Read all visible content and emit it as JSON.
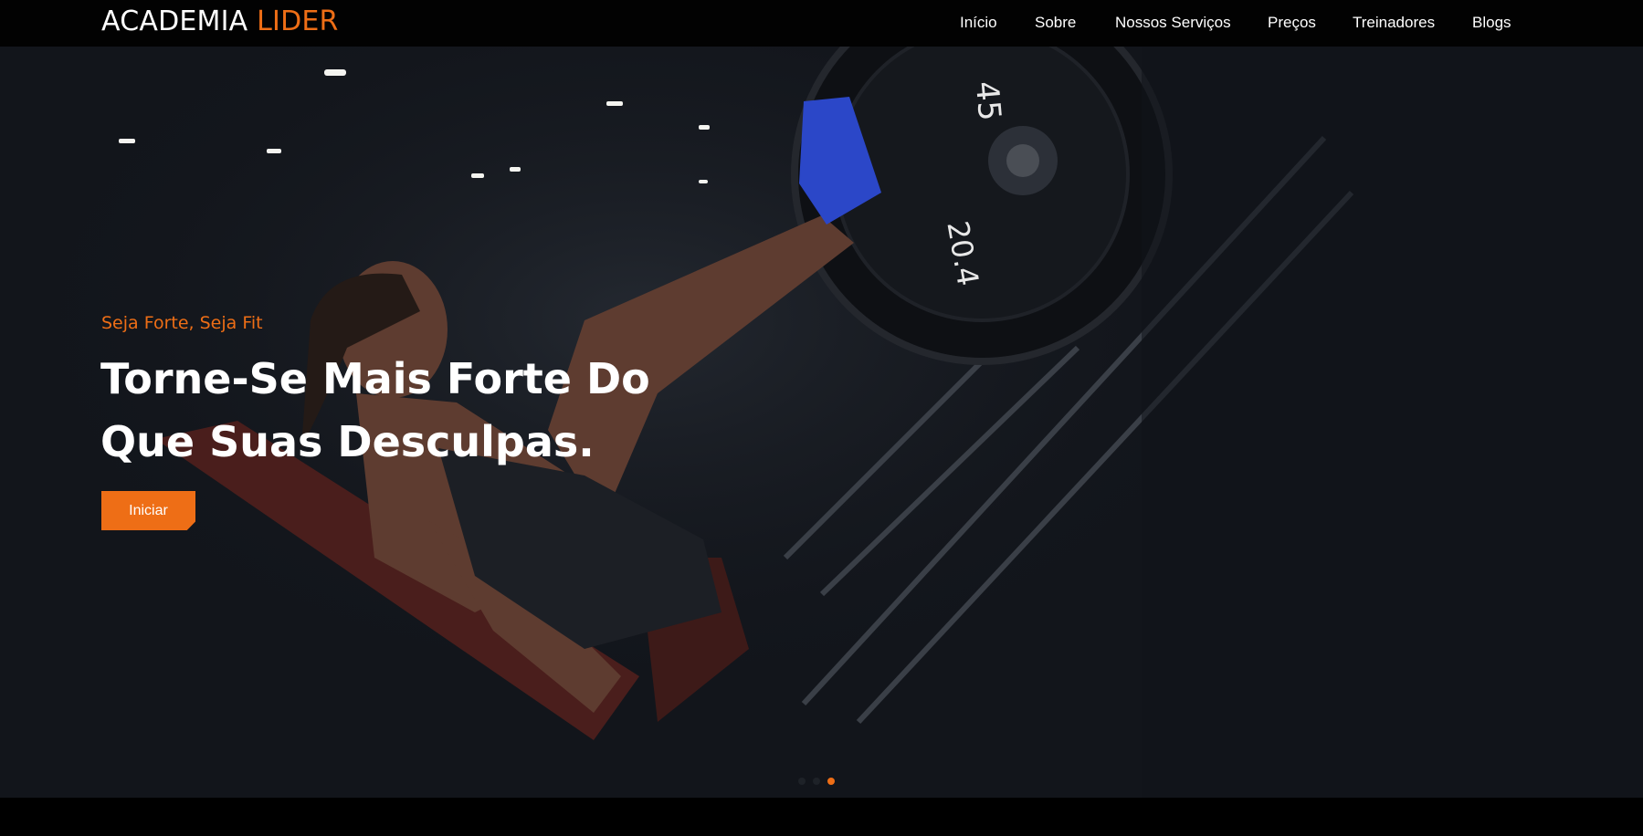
{
  "brand": {
    "main": "ACADEMIA",
    "accent": "LIDER"
  },
  "nav": {
    "items": [
      {
        "label": "Início"
      },
      {
        "label": "Sobre"
      },
      {
        "label": "Nossos Serviços"
      },
      {
        "label": "Preços"
      },
      {
        "label": "Treinadores"
      },
      {
        "label": "Blogs"
      }
    ]
  },
  "hero": {
    "tagline": "Seja Forte, Seja Fit",
    "headline": "Torne-Se Mais Forte Do Que Suas Desculpas.",
    "cta_label": "Iniciar",
    "plate_labels": [
      "45",
      "20.4"
    ],
    "slides": {
      "count": 3,
      "active_index": 2
    }
  },
  "colors": {
    "accent": "#ee6e16",
    "nav_background": "#020202",
    "hero_background": "#13161c"
  }
}
